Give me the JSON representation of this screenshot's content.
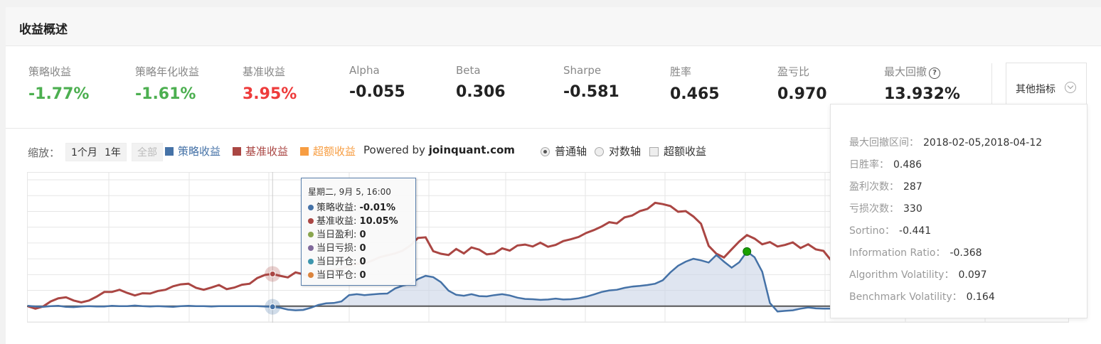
{
  "header": {
    "title": "收益概述"
  },
  "metrics": [
    {
      "label": "策略收益",
      "value": "-1.77%",
      "color": "green"
    },
    {
      "label": "策略年化收益",
      "value": "-1.61%",
      "color": "green"
    },
    {
      "label": "基准收益",
      "value": "3.95%",
      "color": "red"
    },
    {
      "label": "Alpha",
      "value": "-0.055",
      "color": "dark"
    },
    {
      "label": "Beta",
      "value": "0.306",
      "color": "dark"
    },
    {
      "label": "Sharpe",
      "value": "-0.581",
      "color": "dark"
    },
    {
      "label": "胜率",
      "value": "0.465",
      "color": "dark"
    },
    {
      "label": "盈亏比",
      "value": "0.970",
      "color": "dark"
    },
    {
      "label": "最大回撤",
      "value": "13.932%",
      "color": "dark",
      "help": "?"
    }
  ],
  "other_indicators": {
    "label": "其他指标",
    "icon": "chevron-down-icon"
  },
  "dropdown": {
    "items": [
      {
        "label": "最大回撤区间：",
        "value": "2018-02-05,2018-04-12"
      },
      {
        "label": "日胜率：",
        "value": "0.486"
      },
      {
        "label": "盈利次数：",
        "value": "287"
      },
      {
        "label": "亏损次数：",
        "value": "330"
      },
      {
        "label": "Sortino：",
        "value": "-0.441"
      },
      {
        "label": "Information Ratio：",
        "value": "-0.368"
      },
      {
        "label": "Algorithm Volatility：",
        "value": "0.097"
      },
      {
        "label": "Benchmark Volatility：",
        "value": "0.164"
      }
    ]
  },
  "controls": {
    "zoom_label": "缩放：",
    "zoom_buttons": [
      "1个月",
      "1年",
      "全部"
    ],
    "legend": [
      {
        "label": "策略收益",
        "color": "#4572a7"
      },
      {
        "label": "基准收益",
        "color": "#aa4643"
      },
      {
        "label": "超额收益",
        "color": "#f79d42"
      }
    ],
    "powered_prefix": "Powered by",
    "powered_site": "joinquant.com",
    "axis_options": [
      "普通轴",
      "对数轴"
    ],
    "selected_axis": "普通轴",
    "excess_checkbox": "超额收益"
  },
  "tooltip": {
    "date": "星期二, 9月 5, 16:00",
    "rows": [
      {
        "label": "策略收益",
        "value": "-0.01%",
        "color": "#4572a7"
      },
      {
        "label": "基准收益",
        "value": "10.05%",
        "color": "#aa4643"
      },
      {
        "label": "当日盈利",
        "value": "0",
        "color": "#89a54e"
      },
      {
        "label": "当日亏损",
        "value": "0",
        "color": "#80699b"
      },
      {
        "label": "当日开仓",
        "value": "0",
        "color": "#3d96ae"
      },
      {
        "label": "当日平仓",
        "value": "0",
        "color": "#db843d"
      }
    ]
  },
  "chart_data": {
    "type": "line",
    "title": "",
    "xlabel": "",
    "ylabel": "",
    "grid": true,
    "log_scale": false,
    "ylim": [
      -5,
      40
    ],
    "series": [
      {
        "name": "策略收益",
        "color": "#4572a7",
        "values": [
          0.1,
          -0.1,
          -0.2,
          0,
          0.1,
          -0.2,
          -0.3,
          -0.1,
          0,
          -0.1,
          -0.1,
          0.1,
          0,
          0,
          0.2,
          0,
          -0.1,
          0,
          -0.1,
          -0.2,
          0,
          0.1,
          0,
          0,
          -0.1,
          0,
          0,
          0,
          0,
          0,
          0,
          -0.1,
          -0.2,
          -0.5,
          -1.1,
          -1.3,
          -1.2,
          -0.5,
          0.4,
          0.9,
          1,
          1.5,
          3.5,
          3.8,
          3.5,
          3.7,
          3.9,
          4,
          5.6,
          6.5,
          7,
          8.6,
          9.6,
          9.2,
          7.6,
          4.9,
          3.6,
          3.3,
          3.8,
          3.2,
          3.1,
          3.5,
          3.8,
          3.4,
          2.7,
          2.3,
          2.2,
          2,
          2.1,
          2.4,
          2.1,
          2.2,
          2.5,
          3,
          3.7,
          4.5,
          5,
          5.2,
          5.8,
          6.2,
          6.4,
          6.7,
          7.1,
          8.2,
          10.7,
          12.8,
          14.1,
          15,
          14.5,
          13.8,
          16.2,
          14.1,
          12.2,
          13.9,
          17.3,
          15.5,
          10.9,
          1,
          -1.7,
          -1.5,
          -1.3,
          -0.8,
          -0.4,
          -0.7,
          -0.8,
          -0.8,
          -0.7,
          -0.5,
          -0.6,
          -0.9,
          -0.9,
          -0.8,
          -1,
          -1,
          -1.3,
          -1.4,
          -1.4,
          -1.3,
          -1.5,
          -1.7,
          -1.8,
          -2,
          -2.3,
          -2.4,
          -2.3,
          -2.1,
          -2.1,
          -2.3,
          -2.6,
          -2.5,
          -2.6,
          -2.8
        ],
        "marker_point": {
          "date_label": "星期二, 9月 5, 16:00",
          "value": -0.01
        }
      },
      {
        "name": "基准收益",
        "color": "#aa4643",
        "values": [
          0,
          -0.8,
          -0.1,
          1.5,
          2.5,
          2.8,
          1.8,
          1.2,
          1.8,
          3,
          4.5,
          4.5,
          5.2,
          4.2,
          3.4,
          4.1,
          4,
          4.8,
          5.2,
          6.3,
          6.9,
          7.1,
          5.8,
          5.2,
          5.9,
          6.7,
          5.4,
          5.9,
          6.8,
          7.1,
          8.9,
          9.9,
          10.2,
          9.6,
          9.1,
          10.7,
          10.1,
          9.4,
          10.5,
          11.2,
          11.5,
          11.9,
          12.8,
          13.4,
          13.5,
          14.4,
          15.5,
          16.1,
          16.7,
          17.6,
          19.2,
          21.6,
          21.8,
          17.4,
          16.6,
          16.2,
          18.1,
          16.7,
          18.6,
          17.9,
          16.4,
          16.7,
          18.3,
          17.6,
          19.2,
          19.5,
          18.9,
          20.1,
          18.8,
          19.4,
          20.6,
          21.2,
          21.9,
          23.2,
          24.1,
          25.2,
          26.6,
          26.2,
          28.1,
          28.7,
          30.1,
          30.8,
          32.7,
          32.3,
          31.7,
          29.9,
          30.1,
          28.4,
          26.1,
          19.1,
          16.6,
          15.4,
          18,
          20.5,
          22.5,
          21.4,
          19.6,
          20.3,
          18.9,
          19.4,
          20.2,
          18.4,
          19.6,
          18,
          17.5,
          14.5,
          13.1,
          12.6,
          12.2,
          11.6,
          12,
          12.8,
          13.5,
          12.8,
          12.4,
          12.9,
          12.5,
          11.7,
          12.8,
          11.3,
          9.8,
          10.5,
          9.2,
          8.8,
          8.5,
          9.3,
          9.9,
          10.5,
          11.1,
          11.8,
          12.4,
          12.9,
          13.5,
          13.1,
          12.1,
          11.5,
          12.3
        ]
      }
    ],
    "markers": [
      {
        "series": "策略收益",
        "color": "#1aa000"
      }
    ]
  }
}
